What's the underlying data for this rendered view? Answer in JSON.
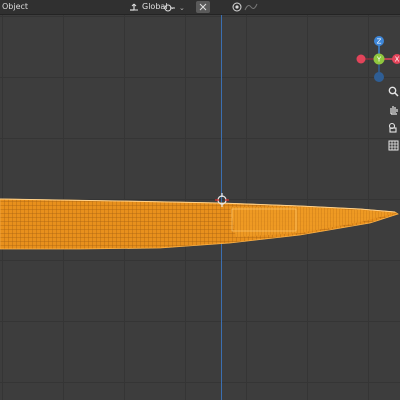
{
  "header": {
    "object_menu_label": "Object",
    "orientation_label": "Global"
  },
  "gizmo": {
    "z_label": "Z",
    "y_label": "Y",
    "x_label": "X"
  },
  "colors": {
    "background": "#3d3d3d",
    "grid": "#353535",
    "header": "#303030",
    "selection": "#f39b1f",
    "z_axis": "#3b6fb1",
    "x_axis": "#e3445a",
    "y_axis": "#8fc73e",
    "z_gizmo": "#3d86d8"
  },
  "icons": {
    "orientation": "orientation-icon",
    "pivot": "pivot-icon",
    "snap": "snap-icon",
    "proportional": "proportional-edit-icon",
    "falloff": "falloff-icon",
    "zoom": "zoom-icon",
    "pan": "hand-pan-icon",
    "camera": "camera-icon",
    "perspective": "grid-perspective-icon"
  }
}
